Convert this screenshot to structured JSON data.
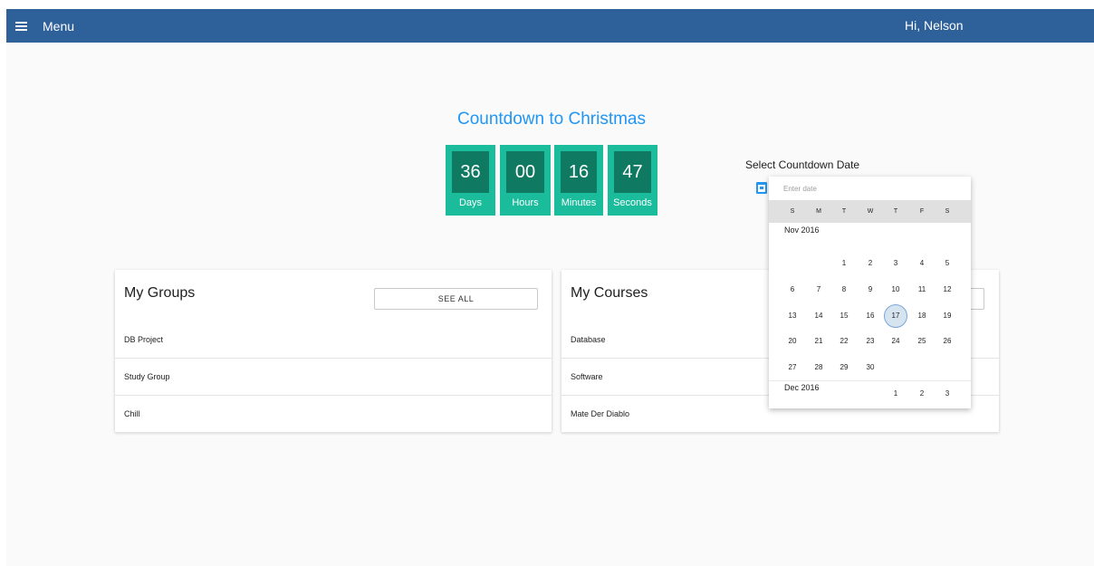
{
  "header": {
    "menu_label": "Menu",
    "greeting": "Hi, Nelson"
  },
  "countdown": {
    "title": "Countdown to Christmas",
    "units": [
      {
        "value": "36",
        "label": "Days"
      },
      {
        "value": "00",
        "label": "Hours"
      },
      {
        "value": "16",
        "label": "Minutes"
      },
      {
        "value": "47",
        "label": "Seconds"
      }
    ]
  },
  "date_picker": {
    "label": "Select Countdown Date",
    "placeholder": "Enter date",
    "weekdays": [
      "S",
      "M",
      "T",
      "W",
      "T",
      "F",
      "S"
    ],
    "months": [
      {
        "name": "Nov 2016",
        "weeks": [
          [
            "",
            "",
            "1",
            "2",
            "3",
            "4",
            "5"
          ],
          [
            "6",
            "7",
            "8",
            "9",
            "10",
            "11",
            "12"
          ],
          [
            "13",
            "14",
            "15",
            "16",
            "17",
            "18",
            "19"
          ],
          [
            "20",
            "21",
            "22",
            "23",
            "24",
            "25",
            "26"
          ],
          [
            "27",
            "28",
            "29",
            "30",
            "",
            "",
            ""
          ]
        ]
      },
      {
        "name": "Dec 2016",
        "weeks": [
          [
            "",
            "",
            "",
            "",
            "1",
            "2",
            "3"
          ]
        ]
      }
    ],
    "selected_day": "17"
  },
  "groups_card": {
    "title": "My Groups",
    "see_all_label": "SEE ALL",
    "items": [
      "DB Project",
      "Study Group",
      "Chill"
    ]
  },
  "courses_card": {
    "title": "My Courses",
    "items": [
      "Database",
      "Software",
      "Mate Der Diablo"
    ]
  },
  "colors": {
    "topbar": "#2e6099",
    "accent": "#2196f3",
    "countdown_tile": "#1abc9c",
    "countdown_number": "#0f7a61"
  }
}
